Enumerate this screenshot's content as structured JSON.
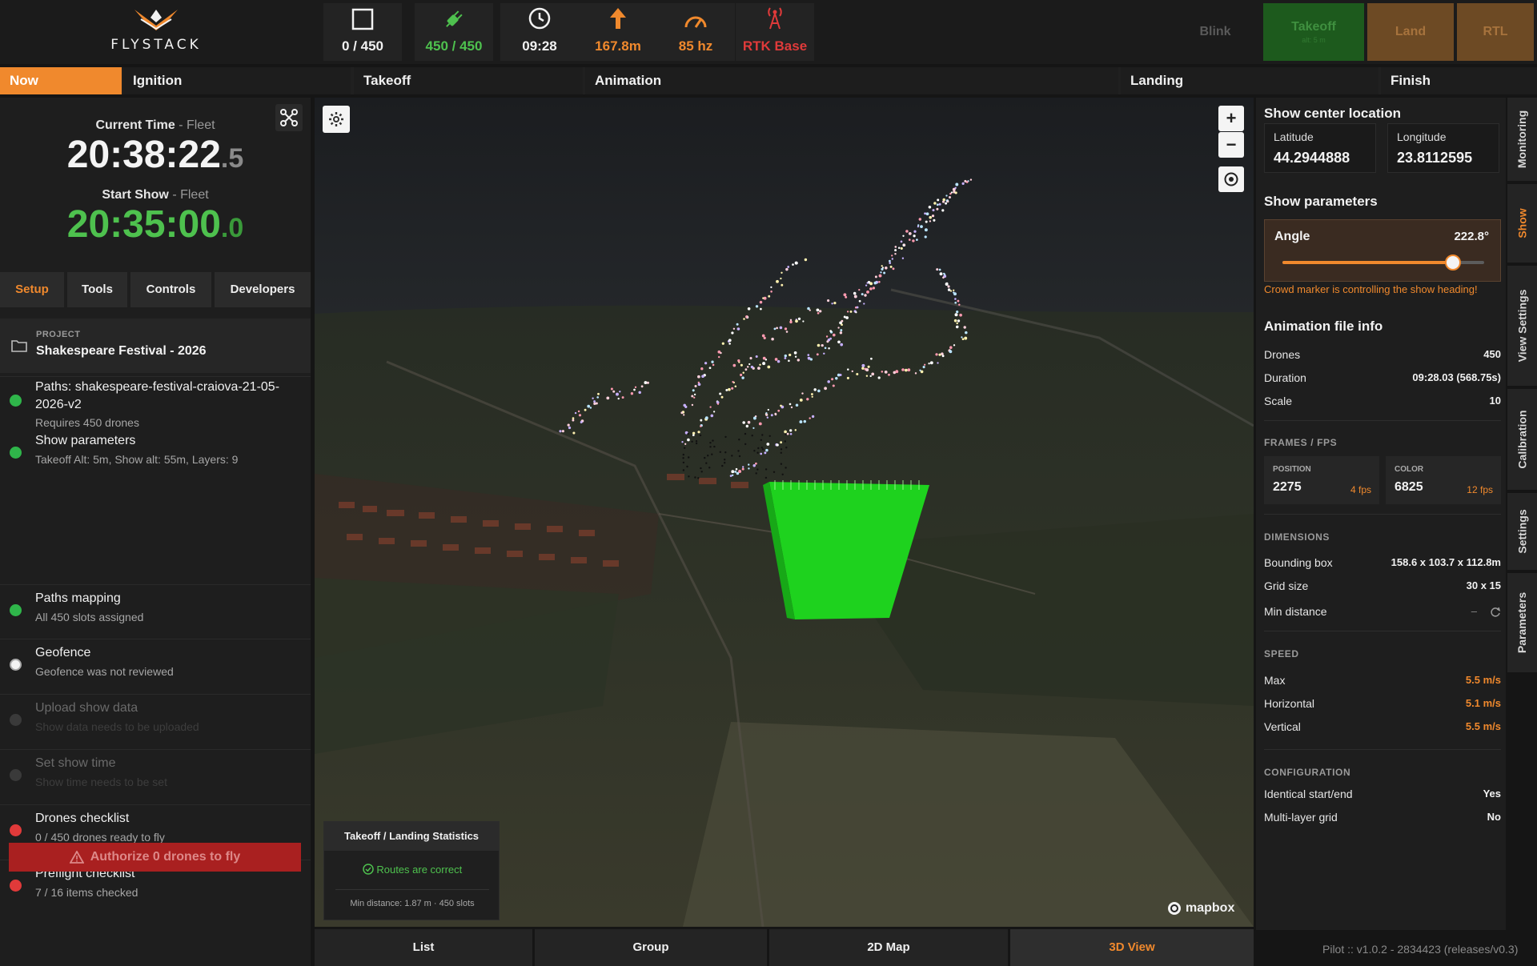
{
  "app": {
    "logo_text": "FLYSTACK"
  },
  "stats": [
    {
      "icon": "square-icon",
      "value": "0 / 450",
      "color": "#f2f2f2"
    },
    {
      "icon": "plug-icon",
      "value": "450 / 450",
      "color": "#4ec14e"
    },
    {
      "icon": "clock-icon",
      "value": "09:28",
      "color": "#f2f2f2"
    },
    {
      "icon": "arrow-up-icon",
      "value": "167.8m",
      "color": "#f0892d"
    },
    {
      "icon": "gauge-icon",
      "value": "85 hz",
      "color": "#f0892d"
    },
    {
      "icon": "antenna-icon",
      "value": "RTK Base",
      "color": "#e03a3a"
    }
  ],
  "actions": {
    "blink": "Blink",
    "takeoff": "Takeoff",
    "takeoff_sub": "alt: 5 m",
    "land": "Land",
    "rtl": "RTL"
  },
  "timeline": {
    "now": "Now",
    "ignition": "Ignition",
    "takeoff": "Takeoff",
    "animation": "Animation",
    "landing": "Landing",
    "finish": "Finish"
  },
  "clock": {
    "current_label": "Current Time",
    "fleet": "- Fleet",
    "current_main": "20:38:22",
    "current_frac": ".5",
    "start_label": "Start Show",
    "start_main": "20:35:00",
    "start_frac": ".0"
  },
  "tabs": {
    "setup": "Setup",
    "tools": "Tools",
    "controls": "Controls",
    "developers": "Developers"
  },
  "project": {
    "label": "PROJECT",
    "name": "Shakespeare Festival - 2026"
  },
  "steps": [
    {
      "title": "Paths: shakespeare-festival-craiova-21-05-2026-v2",
      "sub": "Requires 450 drones",
      "status": "green"
    },
    {
      "title": "Show parameters",
      "sub": "Takeoff Alt: 5m, Show alt: 55m, Layers: 9",
      "status": "green"
    },
    {
      "title": "Paths mapping",
      "sub": "All 450 slots assigned",
      "status": "green"
    },
    {
      "title": "Geofence",
      "sub": "Geofence was not reviewed",
      "status": "white"
    },
    {
      "title": "Upload show data",
      "sub": "Show data needs to be uploaded",
      "status": "gray"
    },
    {
      "title": "Set show time",
      "sub": "Show time needs to be set",
      "status": "gray"
    },
    {
      "title": "Drones checklist",
      "sub": "0 / 450 drones ready to fly",
      "status": "red"
    },
    {
      "title": "Preflight checklist",
      "sub": "7 / 16 items checked",
      "status": "red"
    }
  ],
  "authorize": "Authorize 0 drones to fly",
  "map": {
    "stats_title": "Takeoff / Landing Statistics",
    "routes_ok": "Routes are correct",
    "min_distance": "Min distance: 1.87 m  · 450 slots",
    "attribution": "mapbox"
  },
  "view_tabs": {
    "list": "List",
    "group": "Group",
    "map2d": "2D Map",
    "view3d": "3D View"
  },
  "right": {
    "center_title": "Show center location",
    "lat_label": "Latitude",
    "lat": "44.2944888",
    "lon_label": "Longitude",
    "lon": "23.8112595",
    "params_title": "Show parameters",
    "angle_label": "Angle",
    "angle_value": "222.8°",
    "angle_fraction": 0.846,
    "warning": "Crowd marker is controlling the show heading!",
    "anim_title": "Animation file info",
    "drones_k": "Drones",
    "drones_v": "450",
    "duration_k": "Duration",
    "duration_v": "09:28.03 (568.75s)",
    "scale_k": "Scale",
    "scale_v": "10",
    "frames_title": "FRAMES / FPS",
    "position_k": "POSITION",
    "position_v": "2275",
    "position_f": "4 fps",
    "color_k": "COLOR",
    "color_v": "6825",
    "color_f": "12 fps",
    "dims_title": "DIMENSIONS",
    "bbox_k": "Bounding box",
    "bbox_v": "158.6 x 103.7 x 112.8m",
    "grid_k": "Grid size",
    "grid_v": "30 x 15",
    "mind_k": "Min distance",
    "mind_v": "–",
    "speed_title": "SPEED",
    "max_k": "Max",
    "max_v": "5.5 m/s",
    "hor_k": "Horizontal",
    "hor_v": "5.1 m/s",
    "ver_k": "Vertical",
    "ver_v": "5.5 m/s",
    "config_title": "CONFIGURATION",
    "ident_k": "Identical start/end",
    "ident_v": "Yes",
    "multi_k": "Multi-layer grid",
    "multi_v": "No"
  },
  "side_tabs": [
    "Monitoring",
    "Show",
    "View Settings",
    "Calibration",
    "Settings",
    "Parameters"
  ],
  "version": "Pilot :: v1.0.2 - 2834423 (releases/v0.3)",
  "colors": {
    "accent": "#f0892d",
    "green": "#4ec14e",
    "red": "#e03a3a",
    "panel": "#1e1e1e"
  }
}
